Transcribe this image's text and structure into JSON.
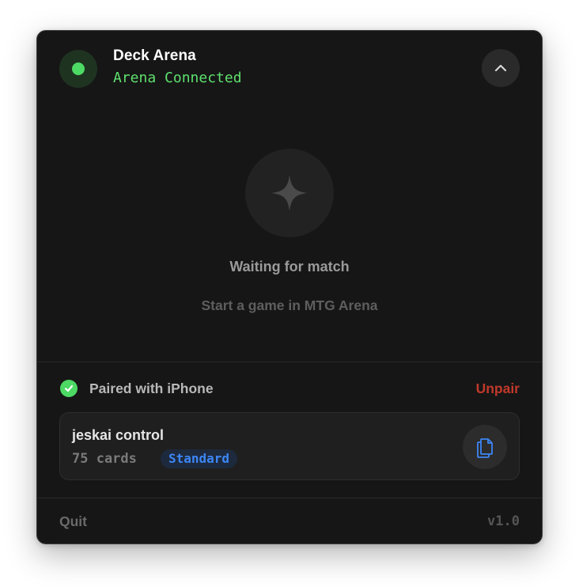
{
  "header": {
    "title": "Deck Arena",
    "status": "Arena Connected",
    "status_color": "#4cd964",
    "collapse_icon": "chevron-up-icon"
  },
  "match": {
    "icon": "sparkle-icon",
    "title": "Waiting for match",
    "subtitle": "Start a game in MTG Arena"
  },
  "pairing": {
    "icon": "checkmark-circle-icon",
    "label": "Paired with iPhone",
    "unpair_label": "Unpair",
    "unpair_color": "#c0392b"
  },
  "deck": {
    "name": "jeskai control",
    "count": "75 cards",
    "format": "Standard",
    "format_color": "#3d86f5",
    "copy_icon": "copy-icon"
  },
  "footer": {
    "quit_label": "Quit",
    "version": "v1.0"
  }
}
